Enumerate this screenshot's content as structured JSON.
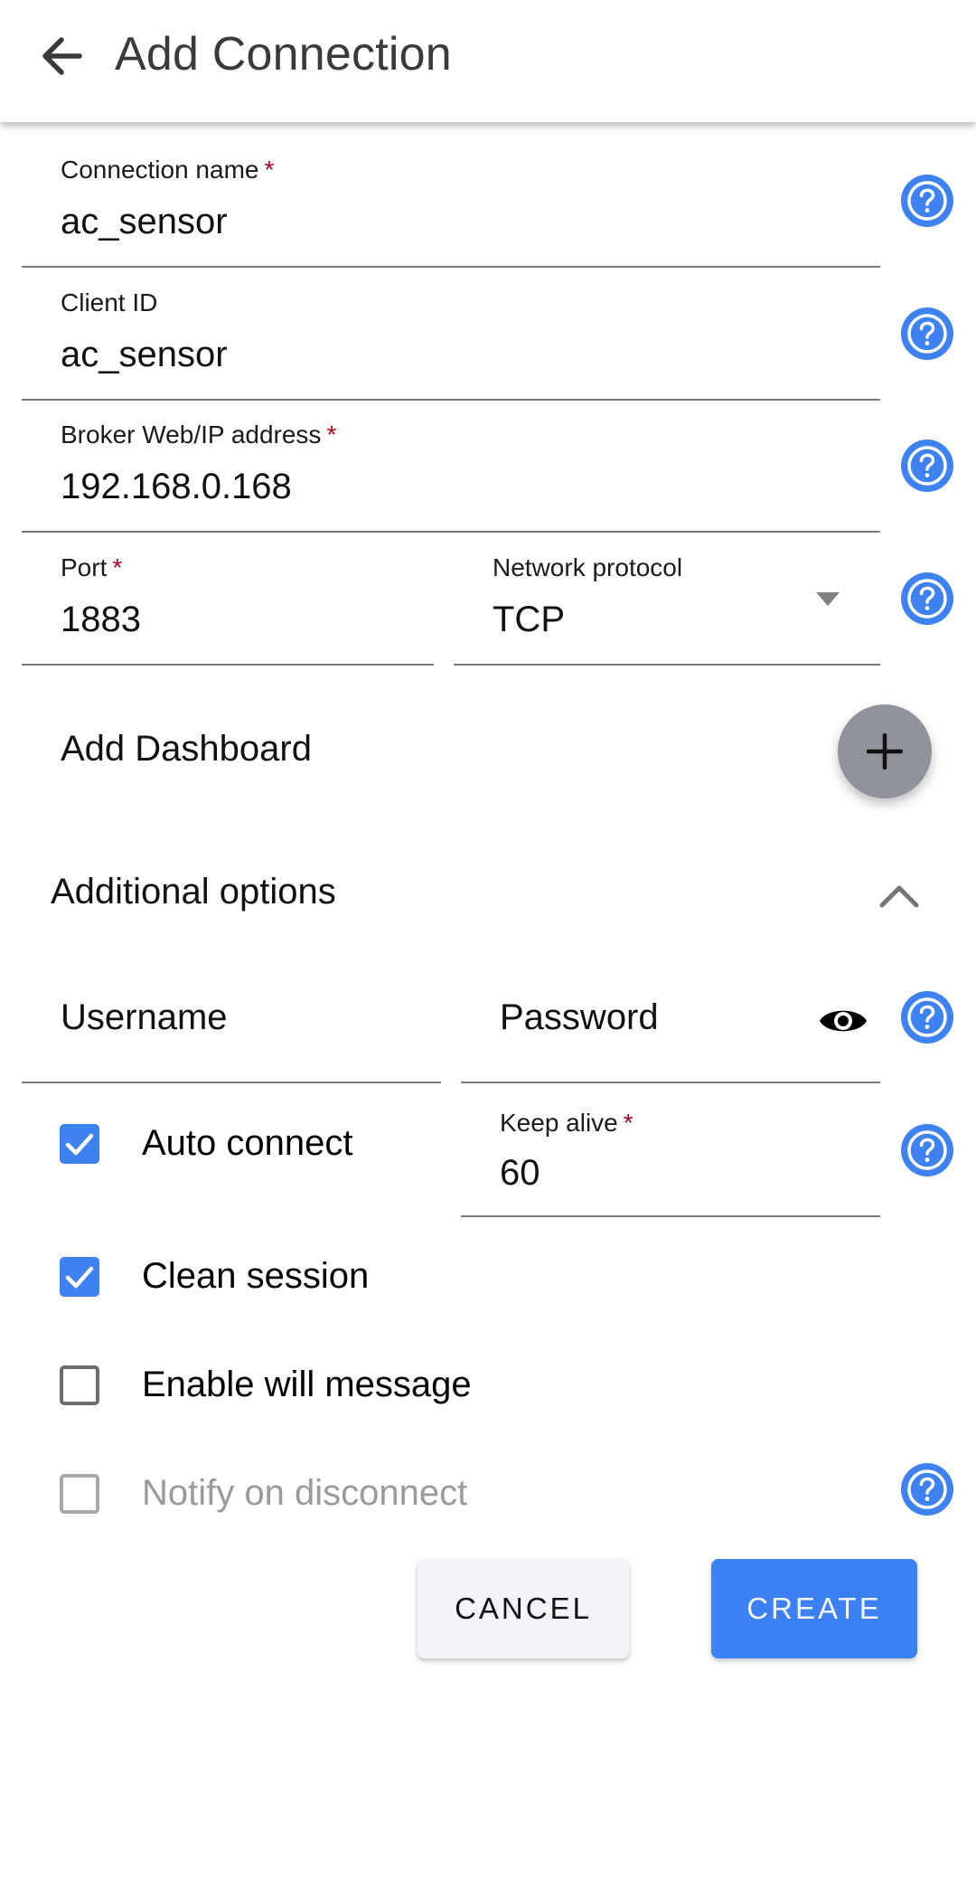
{
  "appbar": {
    "title": "Add Connection",
    "back_icon": "arrow-left-icon"
  },
  "fields": {
    "connection_name": {
      "label": "Connection name",
      "required": "*",
      "value": "ac_sensor"
    },
    "client_id": {
      "label": "Client ID",
      "value": "ac_sensor"
    },
    "broker": {
      "label": "Broker Web/IP address",
      "required": "*",
      "value": "192.168.0.168"
    },
    "port": {
      "label": "Port",
      "required": "*",
      "value": "1883"
    },
    "protocol": {
      "label": "Network protocol",
      "value": "TCP"
    },
    "username": {
      "placeholder": "Username",
      "value": ""
    },
    "password": {
      "placeholder": "Password",
      "value": "",
      "toggle_icon": "eye-icon"
    },
    "keep_alive": {
      "label": "Keep alive",
      "required": "*",
      "value": "60"
    }
  },
  "dashboard": {
    "label": "Add Dashboard",
    "add_icon": "plus-icon"
  },
  "additional": {
    "label": "Additional options",
    "expanded": true,
    "chevron_icon": "chevron-up-icon"
  },
  "checkboxes": [
    {
      "label": "Auto connect",
      "checked": true,
      "disabled": false
    },
    {
      "label": "Clean session",
      "checked": true,
      "disabled": false
    },
    {
      "label": "Enable will message",
      "checked": false,
      "disabled": false
    },
    {
      "label": "Notify on disconnect",
      "checked": false,
      "disabled": true
    }
  ],
  "actions": {
    "cancel": "CANCEL",
    "create": "CREATE"
  },
  "colors": {
    "accent": "#3b80f4",
    "required": "#b00020",
    "fab": "#8f939a",
    "help": "#3d82f0"
  },
  "help_icon": "help-circle-icon"
}
